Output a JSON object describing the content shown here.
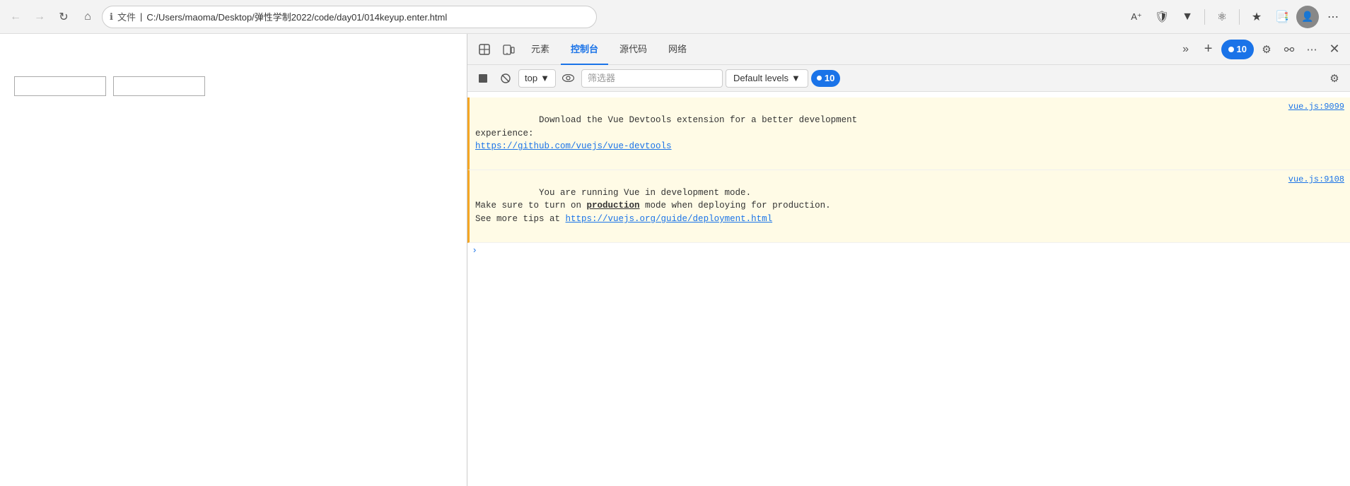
{
  "browser": {
    "back_disabled": true,
    "forward_disabled": true,
    "reload_label": "⟳",
    "home_label": "⌂",
    "address": {
      "icon": "ℹ",
      "file_label": "文件",
      "separator": "|",
      "path": "C:/Users/maoma/Desktop/弹性学制2022/code/day01/014keyup.enter.html"
    },
    "top_right_icons": [
      "A⁺",
      "🛡",
      "▼",
      "⚙",
      "☆",
      "🗔",
      "👤",
      "⋯"
    ]
  },
  "page": {
    "input1_placeholder": "",
    "input2_placeholder": ""
  },
  "devtools": {
    "tabs": [
      {
        "id": "inspect",
        "label": "⬚",
        "icon": true
      },
      {
        "id": "device",
        "label": "📱",
        "icon": true
      },
      {
        "id": "elements",
        "label": "元素"
      },
      {
        "id": "console",
        "label": "控制台",
        "active": true
      },
      {
        "id": "source",
        "label": "源代码"
      },
      {
        "id": "network",
        "label": "网络"
      }
    ],
    "more_tabs_label": "»",
    "add_tab_label": "+",
    "badge_count": "10",
    "settings_label": "⚙",
    "dock_label": "👥",
    "more_label": "⋯",
    "close_label": "✕",
    "toolbar": {
      "record_label": "⬛",
      "clear_label": "🚫",
      "top_dropdown_label": "top",
      "eye_label": "👁",
      "filter_placeholder": "筛选器",
      "default_levels_label": "Default levels",
      "badge_count": "10",
      "settings_label": "⚙"
    },
    "console_entries": [
      {
        "type": "warning",
        "message": "Download the Vue Devtools extension for a better development\nexperience:\nhttps://github.com/vuejs/vue-devtools",
        "link": "https://github.com/vuejs/vue-devtools",
        "link_text": "https://github.com/vuejs/vue-devtools",
        "source": "vue.js:9099",
        "before_link": "Download the Vue Devtools extension for a better development\nexperience:\n"
      },
      {
        "type": "warning",
        "message": "You are running Vue in development mode.\nMake sure to turn on production mode when deploying for production.\nSee more tips at https://vuejs.org/guide/deployment.html",
        "source": "vue.js:9108",
        "before_link": "You are running Vue in development mode.\nMake sure to turn on ",
        "link_text": "production",
        "link2": "https://vuejs.org/guide/deployment.html",
        "link2_text": "https://vuejs.org/guide/deployment.html",
        "after_link": " mode when deploying for production.\nSee more tips at "
      },
      {
        "type": "expand",
        "arrow": "›"
      }
    ]
  }
}
